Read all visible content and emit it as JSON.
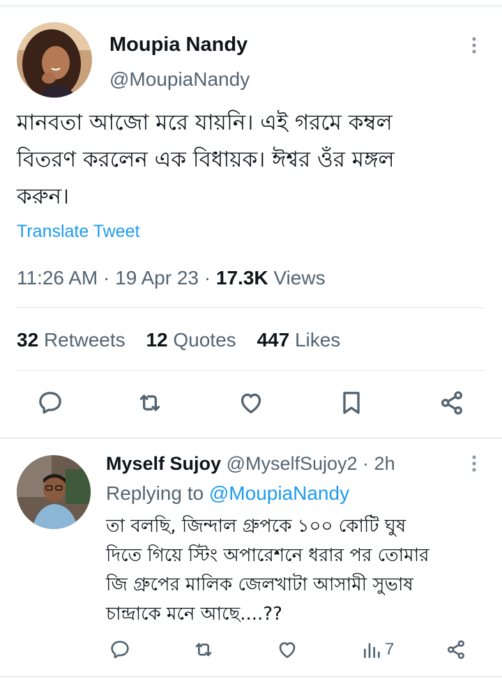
{
  "tweet": {
    "author_name": "Moupia Nandy",
    "author_handle": "@MoupiaNandy",
    "text_lines": [
      "মানবতা আজো মরে যায়নি।  এই গরমে কম্বল",
      "বিতরণ করলেন এক বিধায়ক। ঈশ্বর ওঁর মঙ্গল",
      "করুন।"
    ],
    "translate_label": "Translate Tweet",
    "time": "11:26 AM",
    "date": "19 Apr 23",
    "views_count": "17.3K",
    "views_label": "Views",
    "retweets_count": "32",
    "retweets_label": "Retweets",
    "quotes_count": "12",
    "quotes_label": "Quotes",
    "likes_count": "447",
    "likes_label": "Likes"
  },
  "reply": {
    "author_name": "Myself Sujoy",
    "author_handle": "@MyselfSujoy2",
    "age": "2h",
    "replying_to_label": "Replying to",
    "replying_to_handle": "@MoupiaNandy",
    "text_lines": [
      "তা বলছি, জিন্দাল গ্রুপকে ১০০ কোটি ঘুষ",
      "দিতে গিয়ে স্টিং অপারেশনে ধরার পর তোমার",
      "জি গ্রুপের মালিক জেলখাটা আসামী সুভাষ",
      "চান্দ্রাকে মনে আছে....??"
    ],
    "views_count": "7"
  },
  "icons": {
    "reply": "comment-icon",
    "retweet": "retweet-icon",
    "like": "heart-icon",
    "bookmark": "bookmark-icon",
    "share": "share-icon",
    "views": "analytics-icon",
    "more": "more-vertical-icon"
  },
  "colors": {
    "text_primary": "#0f1419",
    "text_secondary": "#536471",
    "accent": "#1d9bf0"
  }
}
